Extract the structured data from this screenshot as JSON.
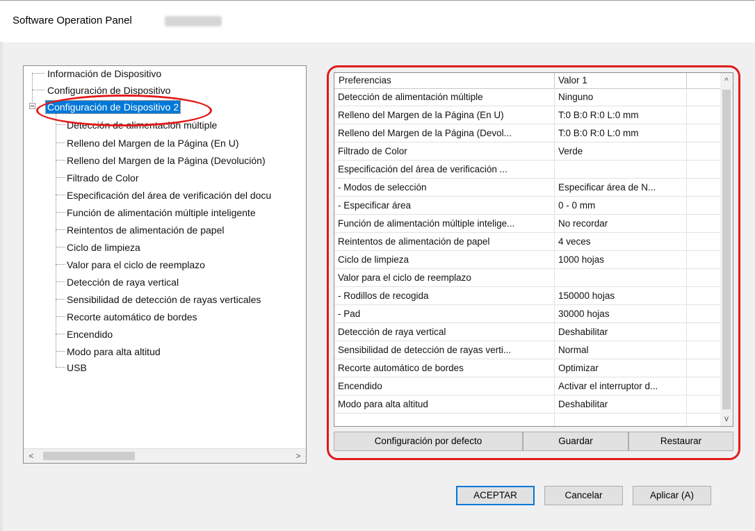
{
  "window": {
    "title": "Software Operation Panel"
  },
  "tree": {
    "items": [
      {
        "label": "Información de Dispositivo"
      },
      {
        "label": "Configuración de Dispositivo"
      },
      {
        "label": "Configuración de Dispositivo 2"
      },
      {
        "label": "Detección de alimentación múltiple"
      },
      {
        "label": "Relleno del Margen de la Página (En U)"
      },
      {
        "label": "Relleno del Margen de la Página (Devolución)"
      },
      {
        "label": "Filtrado de Color"
      },
      {
        "label": "Especificación del área de verificación del docu"
      },
      {
        "label": "Función de alimentación múltiple inteligente"
      },
      {
        "label": "Reintentos de alimentación de papel"
      },
      {
        "label": "Ciclo de limpieza"
      },
      {
        "label": "Valor para el ciclo de reemplazo"
      },
      {
        "label": "Detección de raya vertical"
      },
      {
        "label": "Sensibilidad de detección de rayas verticales"
      },
      {
        "label": "Recorte automático de bordes"
      },
      {
        "label": "Encendido"
      },
      {
        "label": "Modo para alta altitud"
      },
      {
        "label": "USB"
      }
    ],
    "selected": "Configuración de Dispositivo 2",
    "scroll_left": "<",
    "scroll_right": ">"
  },
  "prefs": {
    "columns": [
      "Preferencias",
      "Valor 1"
    ],
    "rows": [
      {
        "name": "Detección de alimentación múltiple",
        "value": "Ninguno"
      },
      {
        "name": "Relleno del Margen de la Página (En U)",
        "value": "T:0  B:0  R:0  L:0 mm"
      },
      {
        "name": "Relleno del Margen de la Página (Devol...",
        "value": "T:0  B:0  R:0  L:0 mm"
      },
      {
        "name": "Filtrado de Color",
        "value": "Verde"
      },
      {
        "name": "Especificación del área de verificación ...",
        "value": ""
      },
      {
        "name": " - Modos de selección",
        "value": "Especificar área de N..."
      },
      {
        "name": " - Especificar área",
        "value": "0 - 0 mm"
      },
      {
        "name": "Función de alimentación múltiple intelige...",
        "value": " No recordar"
      },
      {
        "name": "Reintentos de alimentación de papel",
        "value": "4 veces"
      },
      {
        "name": "Ciclo de limpieza",
        "value": "1000 hojas"
      },
      {
        "name": "Valor para el ciclo de reemplazo",
        "value": ""
      },
      {
        "name": " - Rodillos de recogida",
        "value": "150000 hojas"
      },
      {
        "name": " - Pad",
        "value": "30000 hojas"
      },
      {
        "name": "Detección de raya vertical",
        "value": "Deshabilitar"
      },
      {
        "name": "Sensibilidad de detección de rayas verti...",
        "value": "Normal"
      },
      {
        "name": "Recorte automático de bordes",
        "value": "Optimizar"
      },
      {
        "name": "Encendido",
        "value": "Activar el interruptor d..."
      },
      {
        "name": "Modo para alta altitud",
        "value": "Deshabilitar"
      }
    ],
    "scroll_up": "^",
    "scroll_down": "v"
  },
  "panel_buttons": {
    "default": "Configuración por defecto",
    "save": "Guardar",
    "restore": "Restaurar"
  },
  "dialog_buttons": {
    "ok": "ACEPTAR",
    "cancel": "Cancelar",
    "apply": "Aplicar (A)"
  },
  "colors": {
    "highlight": "#e21a1a",
    "selection": "#0078d7"
  }
}
